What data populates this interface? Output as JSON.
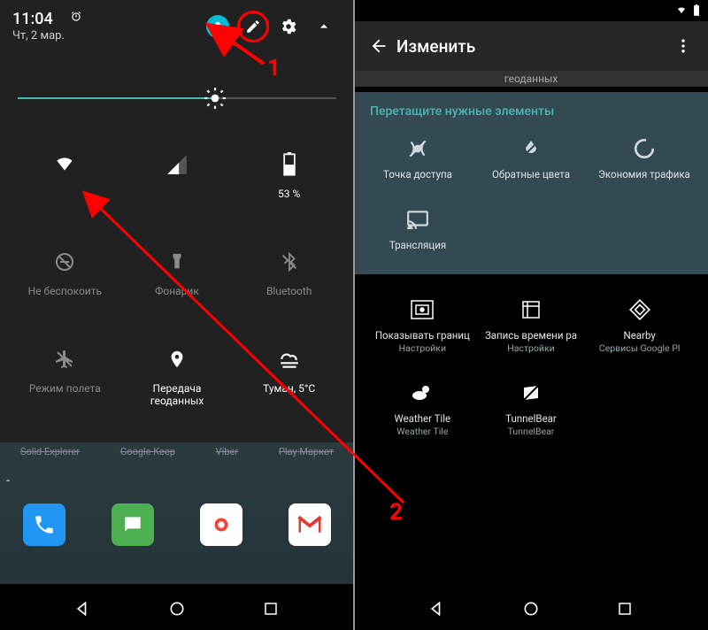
{
  "left": {
    "time": "11:04",
    "date": "Чт, 2 мар.",
    "battery_pct": "53 %",
    "tiles": [
      {
        "label": "",
        "active": true,
        "icon": "wifi"
      },
      {
        "label": "",
        "active": true,
        "icon": "signal"
      },
      {
        "label": "53 %",
        "active": true,
        "icon": "battery"
      },
      {
        "label": "Не беспокоить",
        "active": false,
        "icon": "dnd"
      },
      {
        "label": "Фонарик",
        "active": false,
        "icon": "flashlight"
      },
      {
        "label": "Bluetooth",
        "active": false,
        "icon": "bluetooth"
      },
      {
        "label": "Режим полета",
        "active": false,
        "icon": "airplane"
      },
      {
        "label": "Передача геоданных",
        "active": true,
        "icon": "location"
      },
      {
        "label": "Туман, 5°C",
        "active": true,
        "icon": "weather"
      }
    ],
    "dock_labels": [
      "Solid Explorer",
      "Google Keep",
      "Viber",
      "Play Маркет"
    ]
  },
  "right": {
    "header_title": "Изменить",
    "geo_strip": "геоданных",
    "drag_title": "Перетащите нужные элементы",
    "available": [
      {
        "label": "Точка доступа",
        "icon": "hotspot"
      },
      {
        "label": "Обратные цвета",
        "icon": "invert"
      },
      {
        "label": "Экономия трафика",
        "icon": "datasaver"
      },
      {
        "label": "Трансляция",
        "icon": "cast"
      }
    ],
    "extra": [
      {
        "label": "Показывать границ",
        "sub": "Настройки",
        "icon": "bounds"
      },
      {
        "label": "Запись времени ра",
        "sub": "Настройки",
        "icon": "record"
      },
      {
        "label": "Nearby",
        "sub": "Сервисы Google Pl",
        "icon": "nearby"
      },
      {
        "label": "Weather Tile",
        "sub": "Weather Tile",
        "icon": "weather2"
      },
      {
        "label": "TunnelBear",
        "sub": "TunnelBear",
        "icon": "tunnelbear"
      }
    ]
  },
  "annotations": {
    "a1": "1",
    "a2": "2"
  }
}
